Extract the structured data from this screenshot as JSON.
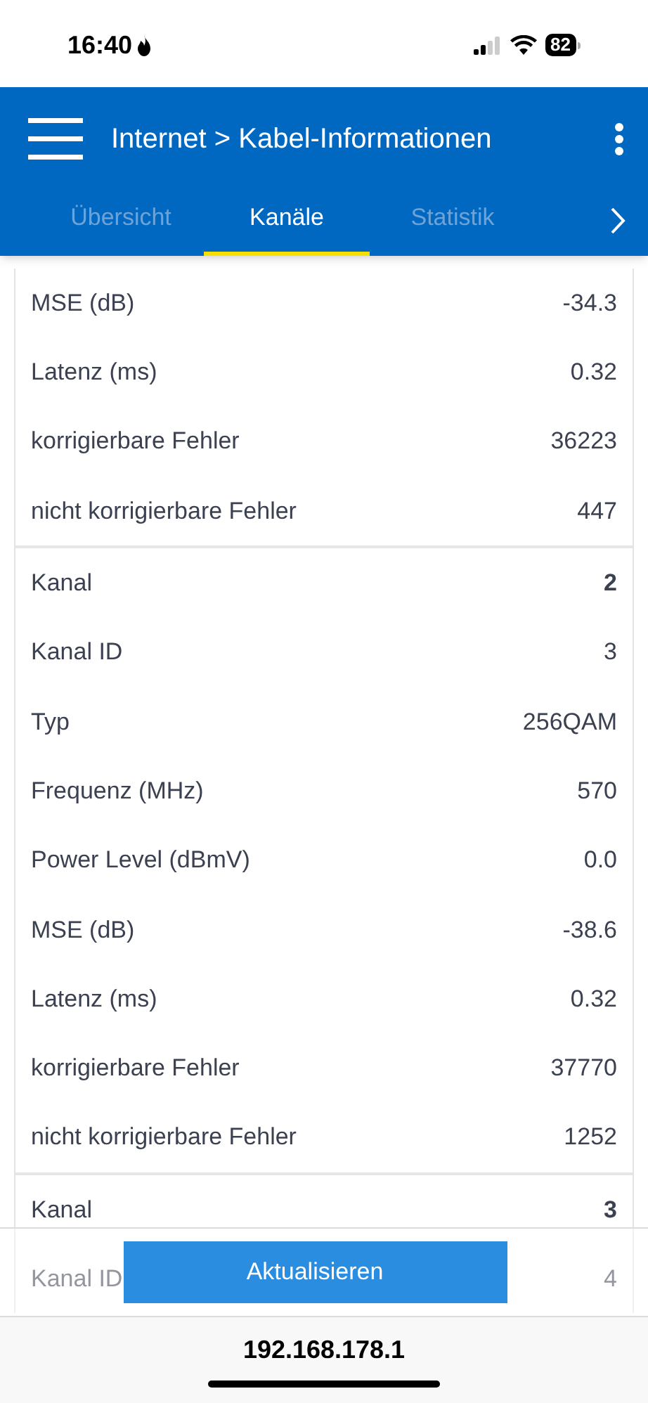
{
  "status_bar": {
    "time": "16:40",
    "battery": "82"
  },
  "header": {
    "title": "Internet > Kabel-Informationen"
  },
  "tabs": [
    {
      "label": "Übersicht",
      "selected": false
    },
    {
      "label": "Kanäle",
      "selected": true
    },
    {
      "label": "Statistik",
      "selected": false
    }
  ],
  "groups": [
    {
      "rows": [
        {
          "label": "MSE (dB)",
          "value": "-34.3",
          "kind": "plain"
        },
        {
          "label": "Latenz (ms)",
          "value": "0.32",
          "kind": "plain"
        },
        {
          "label": "korrigierbare Fehler",
          "value": "36223",
          "kind": "plain"
        },
        {
          "label": "nicht korrigierbare Fehler",
          "value": "447",
          "kind": "plain"
        }
      ]
    },
    {
      "rows": [
        {
          "label": "Kanal",
          "value": "2",
          "kind": "heading"
        },
        {
          "label": "Kanal ID",
          "value": "3",
          "kind": "plain"
        },
        {
          "label": "Typ",
          "value": "256QAM",
          "kind": "plain"
        },
        {
          "label": "Frequenz (MHz)",
          "value": "570",
          "kind": "plain"
        },
        {
          "label": "Power Level (dBmV)",
          "value": "0.0",
          "kind": "plain"
        },
        {
          "label": "MSE (dB)",
          "value": "-38.6",
          "kind": "plain"
        },
        {
          "label": "Latenz (ms)",
          "value": "0.32",
          "kind": "plain"
        },
        {
          "label": "korrigierbare Fehler",
          "value": "37770",
          "kind": "plain"
        },
        {
          "label": "nicht korrigierbare Fehler",
          "value": "1252",
          "kind": "plain"
        }
      ]
    },
    {
      "rows": [
        {
          "label": "Kanal",
          "value": "3",
          "kind": "heading"
        },
        {
          "label": "Kanal ID",
          "value": "4",
          "kind": "plain"
        }
      ]
    }
  ],
  "refresh_button": {
    "label": "Aktualisieren"
  },
  "address_bar": {
    "url": "192.168.178.1"
  }
}
